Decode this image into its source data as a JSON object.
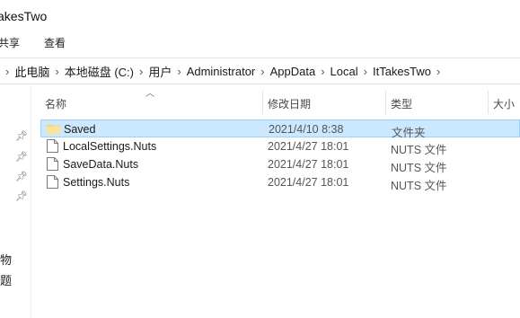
{
  "window": {
    "title": "akesTwo"
  },
  "ribbon": {
    "tabs": [
      "共享",
      "查看"
    ]
  },
  "address": {
    "crumbs": [
      "此电脑",
      "本地磁盘 (C:)",
      "用户",
      "Administrator",
      "AppData",
      "Local",
      "ItTakesTwo"
    ]
  },
  "navpane": {
    "fragments": [
      "物",
      "题"
    ]
  },
  "columns": {
    "name": "名称",
    "date": "修改日期",
    "type": "类型",
    "size": "大小"
  },
  "files": [
    {
      "name": "Saved",
      "date": "2021/4/10 8:38",
      "type": "文件夹",
      "icon": "folder-icon",
      "selected": true
    },
    {
      "name": "LocalSettings.Nuts",
      "date": "2021/4/27 18:01",
      "type": "NUTS 文件",
      "icon": "file-icon",
      "selected": false
    },
    {
      "name": "SaveData.Nuts",
      "date": "2021/4/27 18:01",
      "type": "NUTS 文件",
      "icon": "file-icon",
      "selected": false
    },
    {
      "name": "Settings.Nuts",
      "date": "2021/4/27 18:01",
      "type": "NUTS 文件",
      "icon": "file-icon",
      "selected": false
    }
  ],
  "colors": {
    "selection_bg": "#cce8ff",
    "selection_border": "#99d1ff",
    "folder": "#f8d775"
  }
}
